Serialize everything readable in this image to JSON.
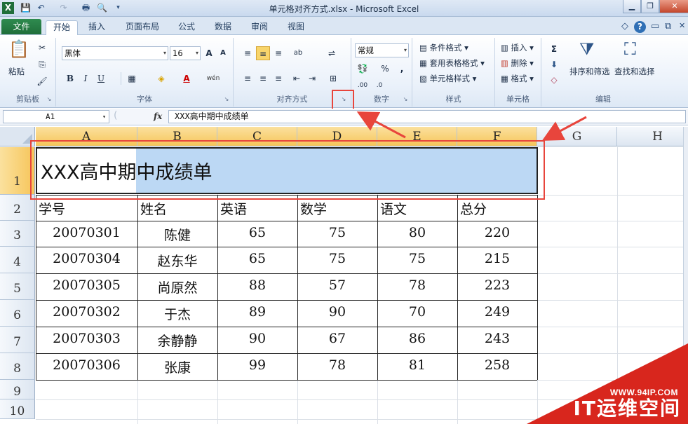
{
  "window": {
    "title": "单元格对齐方式.xlsx - Microsoft Excel",
    "minimize": "▁",
    "restore": "❐",
    "close": "✕"
  },
  "quick_access": [
    "X",
    "💾",
    "↶",
    "↷",
    "🖶",
    "🔍",
    "▾"
  ],
  "tabs": {
    "file": "文件",
    "items": [
      "开始",
      "插入",
      "页面布局",
      "公式",
      "数据",
      "审阅",
      "视图"
    ],
    "active": "开始",
    "right_icons": [
      "◇",
      "?",
      "▭",
      "⧉",
      "✕"
    ]
  },
  "ribbon": {
    "clipboard": {
      "label": "剪贴板",
      "paste": "粘贴",
      "cut_icon": "✂",
      "copy_icon": "⎘",
      "format_painter_icon": "🖌"
    },
    "font": {
      "label": "字体",
      "font_name": "黑体",
      "font_size": "16",
      "grow": "A",
      "shrink": "A",
      "bold": "B",
      "italic": "I",
      "underline": "U",
      "border_icon": "▦",
      "fill_icon": "◈",
      "font_color": "A",
      "phonetic": "wén"
    },
    "alignment": {
      "label": "对齐方式",
      "top": "≡",
      "middle": "≡",
      "bottom": "≡",
      "orient": "ab",
      "wrap": "⇌",
      "left": "≡",
      "center": "≡",
      "right": "≡",
      "dec_indent": "⇤",
      "inc_indent": "⇥",
      "merge": "⊞",
      "launcher": "↘"
    },
    "number": {
      "label": "数字",
      "format": "常规",
      "currency": "💱",
      "percent": "%",
      "comma": ",",
      "inc_dec": ".00",
      "dec_dec": ".0"
    },
    "styles": {
      "label": "样式",
      "conditional": "条件格式",
      "table": "套用表格格式",
      "cell_styles": "单元格样式"
    },
    "cells": {
      "label": "单元格",
      "insert": "插入",
      "delete": "删除",
      "format": "格式"
    },
    "editing": {
      "label": "编辑",
      "sum": "Σ",
      "fill": "⬇",
      "clear": "◇",
      "sort_filter": "排序和筛选",
      "find_select": "查找和选择"
    }
  },
  "formula_bar": {
    "cell_ref": "A1",
    "fx": "fx",
    "content": "XXX高中期中成绩单"
  },
  "sheet": {
    "columns": [
      "A",
      "B",
      "C",
      "D",
      "E",
      "F",
      "G",
      "H"
    ],
    "rows": [
      "1",
      "2",
      "3",
      "4",
      "5",
      "6",
      "7",
      "8",
      "9",
      "10"
    ],
    "title": "XXX高中期中成绩单",
    "headers": [
      "学号",
      "姓名",
      "英语",
      "数学",
      "语文",
      "总分"
    ],
    "data": [
      [
        "20070301",
        "陈健",
        "65",
        "75",
        "80",
        "220"
      ],
      [
        "20070304",
        "赵东华",
        "65",
        "75",
        "75",
        "215"
      ],
      [
        "20070305",
        "尚原然",
        "88",
        "57",
        "78",
        "223"
      ],
      [
        "20070302",
        "于杰",
        "89",
        "90",
        "70",
        "249"
      ],
      [
        "20070303",
        "余静静",
        "90",
        "67",
        "86",
        "243"
      ],
      [
        "20070306",
        "张康",
        "99",
        "78",
        "81",
        "258"
      ]
    ]
  },
  "watermark": {
    "url": "WWW.94IP.COM",
    "name": "IT运维空间"
  },
  "colors": {
    "highlight": "#e8453c",
    "selection": "#bcd8f4",
    "file_tab": "#1f6e3a",
    "watermark": "#d8261d"
  }
}
